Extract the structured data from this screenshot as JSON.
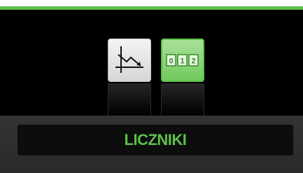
{
  "colors": {
    "accent": "#5cc04a",
    "background": "#000000",
    "panel": "#2f2f2f",
    "label_bar": "#0d0d0d"
  },
  "mode_icons": [
    {
      "name": "chart-trend-icon",
      "selected": false
    },
    {
      "name": "counter-icon",
      "digits": [
        "0",
        "1",
        "2"
      ],
      "selected": true
    }
  ],
  "mode_label": "LICZNIKI"
}
